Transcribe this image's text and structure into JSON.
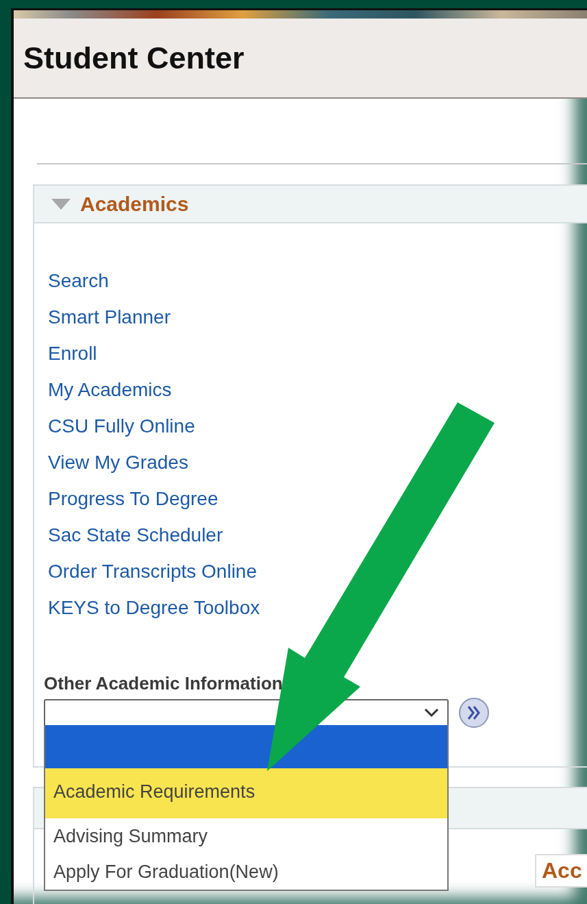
{
  "page": {
    "title": "Student Center"
  },
  "academics": {
    "title": "Academics",
    "expanded": true,
    "links": [
      {
        "label": "Search"
      },
      {
        "label": "Smart Planner"
      },
      {
        "label": "Enroll"
      },
      {
        "label": "My Academics"
      },
      {
        "label": "CSU Fully Online"
      },
      {
        "label": "View My Grades"
      },
      {
        "label": "Progress To Degree"
      },
      {
        "label": "Sac State Scheduler"
      },
      {
        "label": "Order Transcripts Online"
      },
      {
        "label": "KEYS to Degree Toolbox"
      }
    ],
    "other_info": {
      "label": "Other Academic Information",
      "expanded": true,
      "options": [
        {
          "selected": true,
          "highlighted": false
        },
        {
          "text": "Academic Requirements",
          "selected": false,
          "highlighted": true
        },
        {
          "text": "Advising Summary",
          "selected": false,
          "highlighted": false
        },
        {
          "text": "Apply For Graduation(New)",
          "selected": false,
          "highlighted": false
        }
      ]
    }
  },
  "next_section": {
    "heading_fragment": "Acc"
  }
}
